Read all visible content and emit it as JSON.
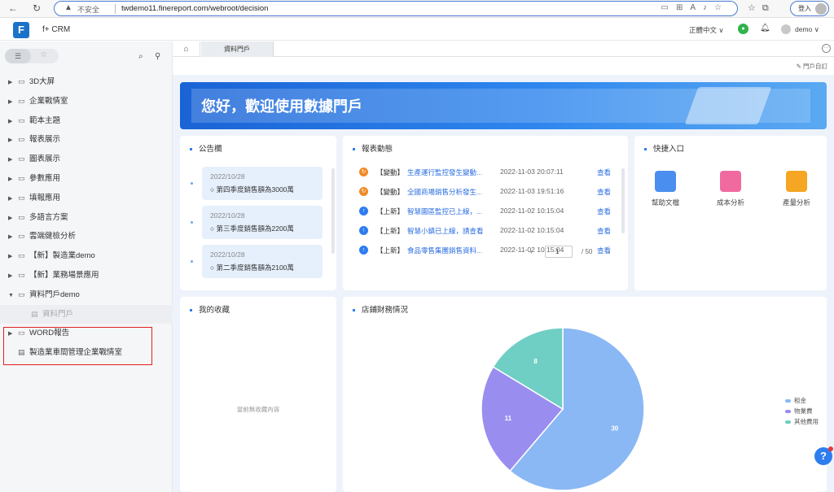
{
  "browser": {
    "insecure_label": "不安全",
    "url": "twdemo11.finereport.com/webroot/decision",
    "login_label": "登入"
  },
  "header": {
    "app_title": "f+ CRM",
    "language": "正體中文",
    "user": "demo"
  },
  "sidebar": {
    "items": [
      {
        "label": "3D大屏",
        "expandable": true
      },
      {
        "label": "企業戰情室",
        "expandable": true
      },
      {
        "label": "範本主題",
        "expandable": true
      },
      {
        "label": "報表展示",
        "expandable": true
      },
      {
        "label": "圖表展示",
        "expandable": true
      },
      {
        "label": "參數應用",
        "expandable": true
      },
      {
        "label": "填報應用",
        "expandable": true
      },
      {
        "label": "多語言方案",
        "expandable": true
      },
      {
        "label": "雲端健檢分析",
        "expandable": true
      },
      {
        "label": "【新】製造業demo",
        "expandable": true
      },
      {
        "label": "【新】業務場景應用",
        "expandable": true
      },
      {
        "label": "資料門戶demo",
        "expandable": true,
        "expanded": true
      },
      {
        "label": "資料門戶",
        "child": true
      },
      {
        "label": "WORD報告",
        "expandable": true
      },
      {
        "label": "製造業車間管理企業戰情室",
        "expandable": false
      }
    ]
  },
  "tabs": {
    "active": "資料門戶"
  },
  "toolbar": {
    "customize_label": "門戶自訂"
  },
  "banner": {
    "title": "您好，歡迎使用數據門戶"
  },
  "announcements": {
    "title": "公告欄",
    "items": [
      {
        "date": "2022/10/28",
        "text": "○ 第四季度銷售額為3000萬"
      },
      {
        "date": "2022/10/28",
        "text": "○ 第三季度銷售額為2200萬"
      },
      {
        "date": "2022/10/28",
        "text": "○ 第二季度銷售額為2100萬"
      }
    ]
  },
  "reports": {
    "title": "報表動態",
    "view_label": "查看",
    "items": [
      {
        "type": "change",
        "tag": "【變動】",
        "title": "生產運行監控發生變動...",
        "time": "2022-11-03 20:07:11"
      },
      {
        "type": "change",
        "tag": "【變動】",
        "title": "全國商場銷售分析發生...",
        "time": "2022-11-03 19:51:16"
      },
      {
        "type": "new",
        "tag": "【上新】",
        "title": "智慧園區監控已上線，...",
        "time": "2022-11-02 10:15:04"
      },
      {
        "type": "new",
        "tag": "【上新】",
        "title": "智慧小鎮已上線，請查看",
        "time": "2022-11-02 10:15:04"
      },
      {
        "type": "new",
        "tag": "【上新】",
        "title": "食品零售集團銷售資料...",
        "time": "2022-11-02 10:15:04"
      }
    ],
    "pager": {
      "current": "1",
      "total": "/ 50"
    }
  },
  "quick_entry": {
    "title": "快捷入口",
    "items": [
      {
        "label": "幫助文檔",
        "color": "#4a8ef0",
        "icon": "help-doc-icon"
      },
      {
        "label": "成本分析",
        "color": "#f06aa0",
        "icon": "cost-analysis-icon"
      },
      {
        "label": "產量分析",
        "color": "#f5a623",
        "icon": "output-analysis-icon"
      }
    ]
  },
  "favorites": {
    "title": "我的收藏",
    "empty_text": "當前無收藏內容"
  },
  "finance": {
    "title": "店鋪財務情況"
  },
  "chart_data": {
    "type": "pie",
    "title": "店鋪財務情況",
    "categories": [
      "租金",
      "物業費",
      "其他費用"
    ],
    "values": [
      30,
      11,
      8
    ],
    "colors": [
      "#8ab8f5",
      "#9a8df0",
      "#6fcfc4"
    ],
    "legend_position": "right"
  }
}
